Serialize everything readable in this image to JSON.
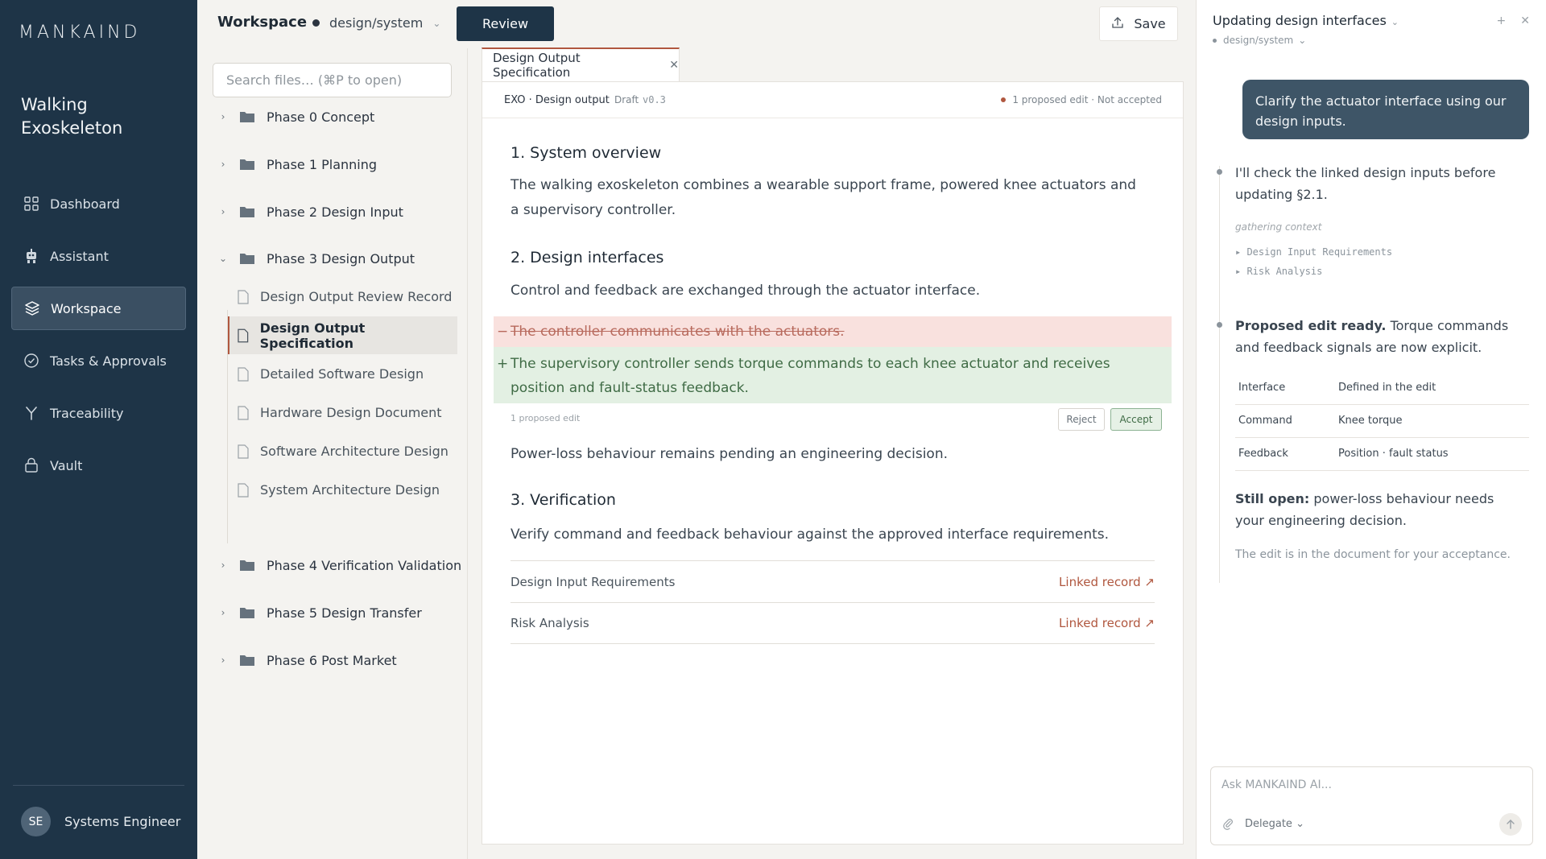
{
  "nav": {
    "logo": "MANKAIND",
    "project": "Walking Exoskeleton",
    "items": [
      {
        "label": "Dashboard",
        "icon": "grid-icon"
      },
      {
        "label": "Assistant",
        "icon": "robot-icon"
      },
      {
        "label": "Workspace",
        "icon": "layers-icon"
      },
      {
        "label": "Tasks & Approvals",
        "icon": "check-circle-icon"
      },
      {
        "label": "Traceability",
        "icon": "branch-icon"
      },
      {
        "label": "Vault",
        "icon": "lock-icon"
      }
    ],
    "active": "Workspace",
    "user": {
      "initials": "SE",
      "name": "Systems Engineer"
    }
  },
  "topbar": {
    "title": "Workspace",
    "branch": "design/system",
    "review_label": "Review",
    "save_label": "Save"
  },
  "tree": {
    "search_placeholder": "Search files… (⌘P to open)",
    "folders": [
      "Phase 0 Concept",
      "Phase 1 Planning",
      "Phase 2 Design Input",
      "Phase 3 Design Output",
      "Phase 4 Verification Validation",
      "Phase 5 Design Transfer",
      "Phase 6 Post Market"
    ],
    "open_folder": "Phase 3 Design Output",
    "files": [
      "Design Output Review Record",
      "Design Output Specification",
      "Detailed Software Design",
      "Hardware Design Document",
      "Software Architecture Design",
      "System Architecture Design"
    ],
    "active_file": "Design Output Specification"
  },
  "doc": {
    "tab_label": "Design Output Specification",
    "crumb": "EXO · Design output",
    "draft": "Draft",
    "version": "v0.3",
    "status": "1 proposed edit · Not accepted",
    "s1_title": "1. System overview",
    "s1_body": "The walking exoskeleton combines a wearable support frame, powered knee actuators and a supervisory controller.",
    "s2_title": "2. Design interfaces",
    "s2_body": "Control and feedback are exchanged through the actuator interface.",
    "diff_removed": "The controller communicates with the actuators.",
    "diff_added": "The supervisory controller sends torque commands to each knee actuator and receives position and fault-status feedback.",
    "diff_minus": "−",
    "diff_plus": "+",
    "diff_meta": "1 proposed edit",
    "reject_label": "Reject",
    "accept_label": "Accept",
    "s2_pending": "Power-loss behaviour remains pending an engineering decision.",
    "s3_title": "3. Verification",
    "s3_body": "Verify command and feedback behaviour against the approved interface requirements.",
    "links": [
      {
        "name": "Design Input Requirements",
        "link": "Linked record ↗"
      },
      {
        "name": "Risk Analysis",
        "link": "Linked record ↗"
      }
    ]
  },
  "panel": {
    "title": "Updating design interfaces",
    "branch": "design/system",
    "user_msg": "Clarify the actuator interface using our design inputs.",
    "msg1": "I'll check the linked design inputs before updating §2.1.",
    "gathering": "gathering context",
    "ctx": [
      "▸ Design Input Requirements",
      "▸ Risk Analysis"
    ],
    "msg2_bold": "Proposed edit ready.",
    "msg2_rest": " Torque commands and feedback signals are now explicit.",
    "table": {
      "headers": [
        "Interface",
        "Defined in the edit"
      ],
      "rows": [
        [
          "Command",
          "Knee torque"
        ],
        [
          "Feedback",
          "Position · fault status"
        ]
      ]
    },
    "still_bold": "Still open:",
    "still_rest": " power-loss behaviour needs your engineering decision.",
    "note": "The edit is in the document for your acceptance.",
    "composer_placeholder": "Ask MANKAIND AI...",
    "delegate_label": "Delegate ⌄"
  },
  "colors": {
    "nav_bg": "#1e3447",
    "accent": "#b0573f",
    "diff_removed_bg": "#f9e1de",
    "diff_added_bg": "#e3f0e3"
  }
}
